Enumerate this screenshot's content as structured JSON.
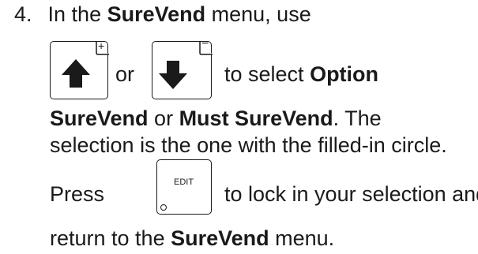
{
  "step": {
    "number": "4.",
    "line1": {
      "t1": "In the ",
      "b1": "SureVend",
      "t2": " menu, use"
    },
    "line2": {
      "or": "or",
      "t1": "to select ",
      "b1": "Option"
    },
    "line3": {
      "b1": "SureVend",
      "t1": " or ",
      "b2": "Must SureVend",
      "t2": ". The"
    },
    "line4": {
      "t1": "selection is the one with the filled-in circle."
    },
    "line5": {
      "press": "Press",
      "t1": "to lock in your selection and"
    },
    "line6": {
      "t1": "return to the ",
      "b1": "SureVend",
      "t2": " menu."
    }
  },
  "keys": {
    "up": {
      "icon": "up-arrow-icon",
      "badge": "+"
    },
    "down": {
      "icon": "down-arrow-icon",
      "badge": "−"
    },
    "edit": {
      "label": "EDIT",
      "icon": "circle-indicator-icon"
    }
  },
  "colors": {
    "text": "#1a1a1a",
    "background": "#ffffff"
  }
}
